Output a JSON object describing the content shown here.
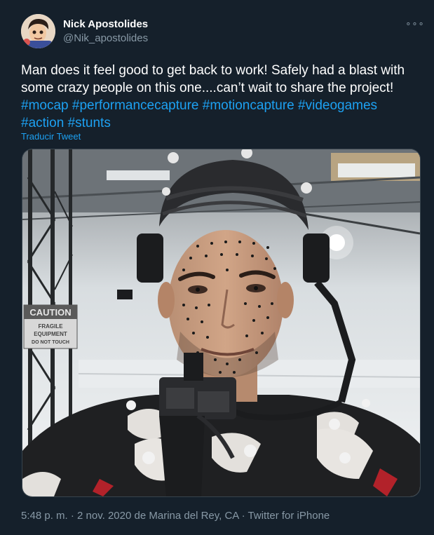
{
  "author": {
    "name": "Nick Apostolides",
    "handle": "@Nik_apostolides",
    "avatar_icon": "cartoon-avatar"
  },
  "more_icon": "more-icon",
  "more_glyph": "∘∘∘",
  "tweet": {
    "text_lines": [
      "Man does it feel good to get back to work! Safely had a blast with",
      "some crazy people on this one....can’t wait to share the project!"
    ],
    "hashtags": [
      "#mocap",
      "#performancecapture",
      "#motioncapture",
      "#videogames",
      "#action",
      "#stunts"
    ],
    "translate_label": "Traducir Tweet"
  },
  "media": {
    "sign_caution": "CAUTION",
    "sign_line1": "FRAGILE",
    "sign_line2": "EQUIPMENT",
    "sign_line3": "DO NOT TOUCH"
  },
  "meta": {
    "time": "5:48 p. m.",
    "sep1": " · ",
    "date": "2 nov. 2020",
    "from": " de ",
    "location": "Marina del Rey, CA",
    "sep2": " · ",
    "source": "Twitter for iPhone"
  },
  "colors": {
    "background": "#15202b",
    "text": "#ffffff",
    "muted": "#8899a6",
    "link": "#1da1f2"
  }
}
